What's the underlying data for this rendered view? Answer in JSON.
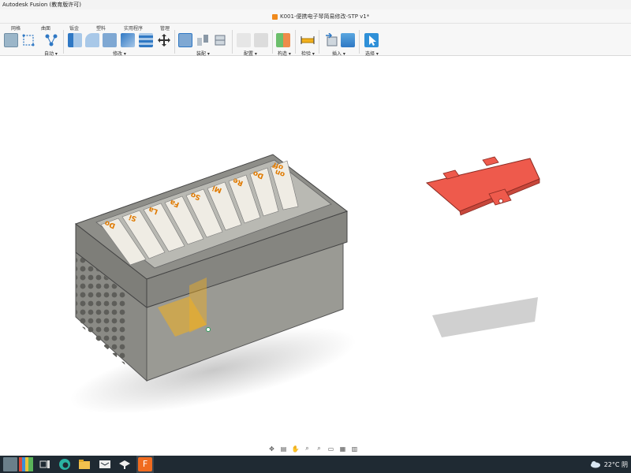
{
  "window": {
    "title": "Autodesk Fusion (教育版许可)",
    "document_name": "K001-便携电子琴简易修改-STP v1*"
  },
  "toolbar": {
    "tabs": [
      "网格",
      "曲面",
      "钣金",
      "塑料",
      "实用程序",
      "管理"
    ],
    "groups": [
      {
        "label": "自动 ▾"
      },
      {
        "label": "修改 ▾"
      },
      {
        "label": "装配 ▾"
      },
      {
        "label": "配置 ▾"
      },
      {
        "label": "构造 ▾"
      },
      {
        "label": "检验 ▾"
      },
      {
        "label": "插入 ▾"
      },
      {
        "label": "选择 ▾"
      }
    ]
  },
  "model": {
    "key_labels": [
      "Do",
      "Re",
      "Mi",
      "Fa",
      "So",
      "La",
      "Si",
      "Do",
      "on",
      "off"
    ],
    "colors": {
      "body": "#8f8f8a",
      "lid": "#8a8a85",
      "keys": "#efece4",
      "key_text": "#e07a00",
      "cover_part": "#ee5a4c",
      "gizmo": "#f2b01e"
    }
  },
  "navbar": {
    "tools": [
      "orbit-icon",
      "look-icon",
      "pan-icon",
      "zoom-icon",
      "fit-icon",
      "display-icon",
      "grid-icon",
      "viewports-icon"
    ]
  },
  "taskbar": {
    "weather": "22°C 阴",
    "apps": [
      "task-view-icon",
      "edge-icon",
      "file-explorer-icon",
      "education-icon",
      "fusion-icon"
    ]
  }
}
